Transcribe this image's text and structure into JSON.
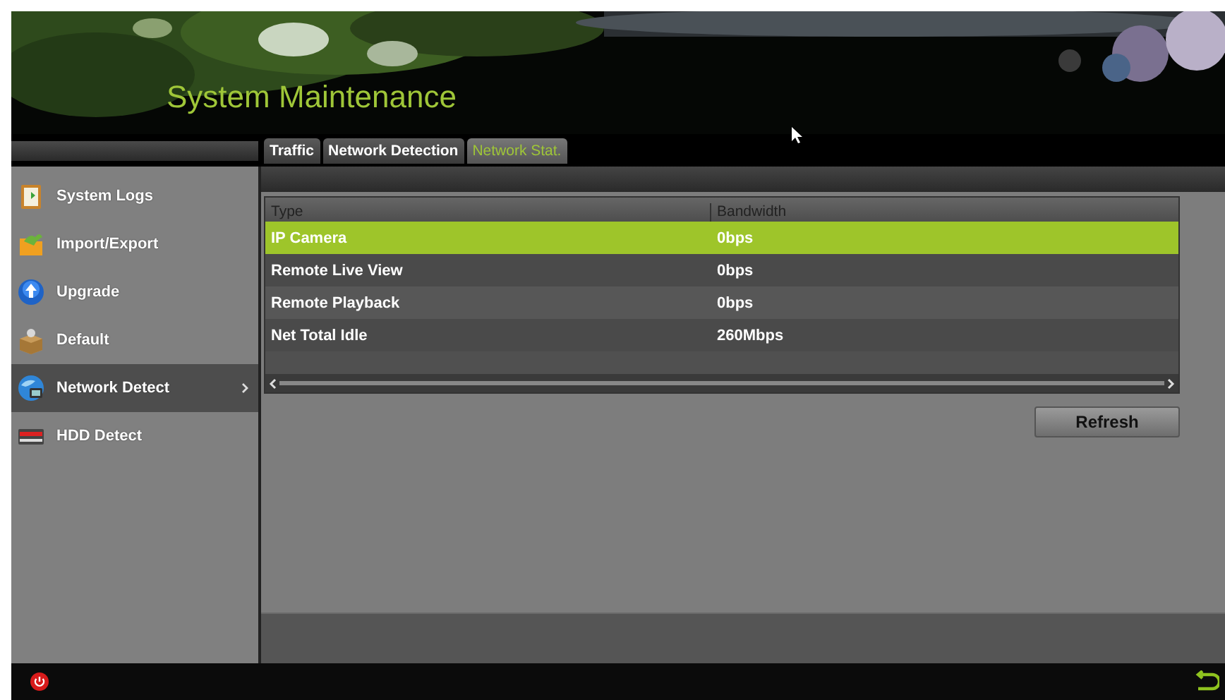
{
  "window": {
    "title": "System Maintenance"
  },
  "tabs": [
    {
      "label": "Traffic",
      "selected": false
    },
    {
      "label": "Network Detection",
      "selected": false
    },
    {
      "label": "Network Stat.",
      "selected": true
    }
  ],
  "sidebar": {
    "items": [
      {
        "label": "System Logs",
        "selected": false
      },
      {
        "label": "Import/Export",
        "selected": false
      },
      {
        "label": "Upgrade",
        "selected": false
      },
      {
        "label": "Default",
        "selected": false
      },
      {
        "label": "Network Detect",
        "selected": true
      },
      {
        "label": "HDD Detect",
        "selected": false
      }
    ]
  },
  "table": {
    "columns": [
      "Type",
      "Bandwidth"
    ],
    "rows": [
      {
        "cells": [
          "IP Camera",
          "0bps"
        ],
        "selected": true
      },
      {
        "cells": [
          "Remote Live View",
          "0bps"
        ],
        "selected": false
      },
      {
        "cells": [
          "Remote Playback",
          "0bps"
        ],
        "selected": false
      },
      {
        "cells": [
          "Net Total Idle",
          "260Mbps"
        ],
        "selected": false
      }
    ]
  },
  "buttons": [
    "Refresh"
  ]
}
